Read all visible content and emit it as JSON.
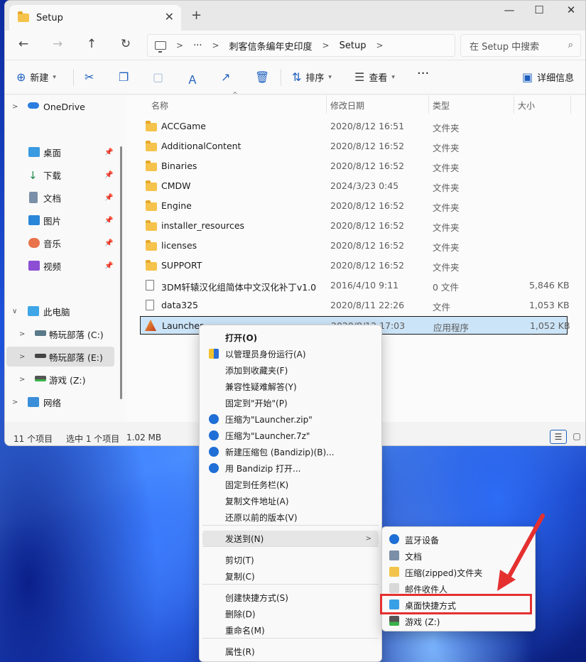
{
  "window": {
    "tab_title": "Setup",
    "tab_close": "✕",
    "tab_add": "+",
    "controls": {
      "minimize": "—",
      "maximize": "☐",
      "close": "✕"
    }
  },
  "nav": {
    "back": "←",
    "forward": "→",
    "up": "↑",
    "refresh": "↻"
  },
  "breadcrumb": {
    "ellipsis": "···",
    "items": [
      "刺客信条编年史印度",
      "Setup"
    ]
  },
  "search": {
    "placeholder": "在 Setup 中搜索"
  },
  "toolbar": {
    "new_label": "新建",
    "sort_label": "排序",
    "view_label": "查看",
    "more_label": "···",
    "details_label": "详细信息"
  },
  "sidebar": {
    "onedrive": "OneDrive",
    "quick": [
      "桌面",
      "下载",
      "文档",
      "图片",
      "音乐",
      "视频"
    ],
    "this_pc": "此电脑",
    "drives": [
      "畅玩部落 (C:)",
      "畅玩部落 (E:)",
      "游戏 (Z:)"
    ],
    "network": "网络"
  },
  "columns": {
    "name": "名称",
    "modified": "修改日期",
    "type": "类型",
    "size": "大小"
  },
  "files": [
    {
      "name": "ACCGame",
      "modified": "2020/8/12 16:51",
      "type": "文件夹",
      "size": "",
      "kind": "folder"
    },
    {
      "name": "AdditionalContent",
      "modified": "2020/8/12 16:52",
      "type": "文件夹",
      "size": "",
      "kind": "folder"
    },
    {
      "name": "Binaries",
      "modified": "2020/8/12 16:52",
      "type": "文件夹",
      "size": "",
      "kind": "folder"
    },
    {
      "name": "CMDW",
      "modified": "2024/3/23 0:45",
      "type": "文件夹",
      "size": "",
      "kind": "folder"
    },
    {
      "name": "Engine",
      "modified": "2020/8/12 16:52",
      "type": "文件夹",
      "size": "",
      "kind": "folder"
    },
    {
      "name": "installer_resources",
      "modified": "2020/8/12 16:52",
      "type": "文件夹",
      "size": "",
      "kind": "folder"
    },
    {
      "name": "licenses",
      "modified": "2020/8/12 16:52",
      "type": "文件夹",
      "size": "",
      "kind": "folder"
    },
    {
      "name": "SUPPORT",
      "modified": "2020/8/12 16:52",
      "type": "文件夹",
      "size": "",
      "kind": "folder"
    },
    {
      "name": "3DM轩辕汉化组简体中文汉化补丁v1.0",
      "modified": "2016/4/10 9:11",
      "type": "0 文件",
      "size": "5,846 KB",
      "kind": "file"
    },
    {
      "name": "data325",
      "modified": "2020/8/11 22:26",
      "type": "文件",
      "size": "1,053 KB",
      "kind": "file"
    },
    {
      "name": "Launcher",
      "modified": "2020/8/12 17:03",
      "type": "应用程序",
      "size": "1,052 KB",
      "kind": "app"
    }
  ],
  "status": {
    "count": "11 个项目",
    "selected": "选中 1 个项目",
    "size": "1.02 MB"
  },
  "context_menu": {
    "items": [
      "打开(O)",
      "以管理员身份运行(A)",
      "添加到收藏夹(F)",
      "兼容性疑难解答(Y)",
      "固定到\"开始\"(P)",
      "压缩为\"Launcher.zip\"",
      "压缩为\"Launcher.7z\"",
      "新建压缩包 (Bandizip)(B)...",
      "用 Bandizip 打开...",
      "固定到任务栏(K)",
      "复制文件地址(A)",
      "还原以前的版本(V)",
      "发送到(N)",
      "剪切(T)",
      "复制(C)",
      "创建快捷方式(S)",
      "删除(D)",
      "重命名(M)",
      "属性(R)"
    ]
  },
  "send_to_menu": {
    "items": [
      "蓝牙设备",
      "文档",
      "压缩(zipped)文件夹",
      "邮件收件人",
      "桌面快捷方式",
      "游戏 (Z:)"
    ]
  },
  "colors": {
    "accent": "#1d5fbf",
    "selection": "#cce4f7",
    "highlight_box": "#e53030",
    "folder": "#f5c34b"
  }
}
